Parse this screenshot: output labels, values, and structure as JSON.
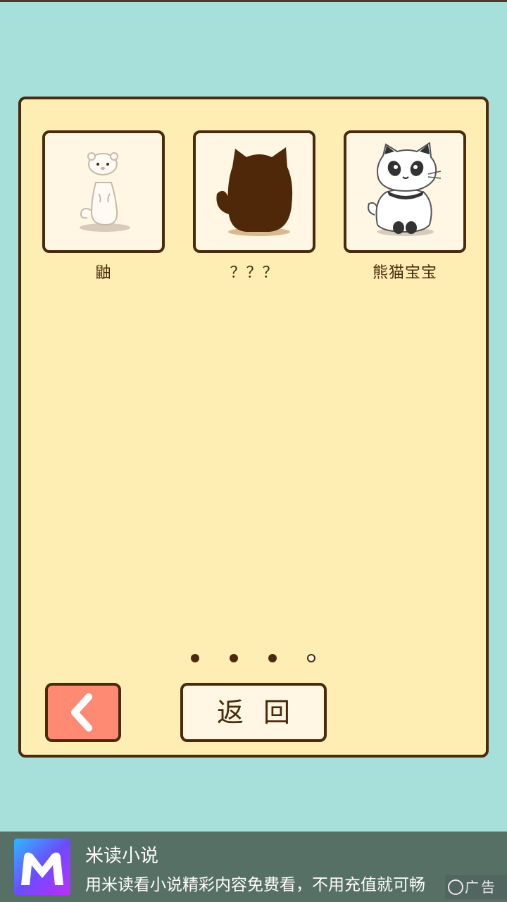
{
  "cards": [
    {
      "label": "鼬",
      "image": "weasel-image"
    },
    {
      "label": "？？？",
      "image": "locked-silhouette-cat"
    },
    {
      "label": "熊猫宝宝",
      "image": "panda-cat-image"
    }
  ],
  "pagination": {
    "total": 4,
    "current": 4
  },
  "buttons": {
    "prev_icon": "chevron-left-icon",
    "back_label": "返回"
  },
  "ad": {
    "app_name": "米读小说",
    "description": "用米读看小说精彩内容免费看，不用充值就可畅",
    "badge": "广告"
  },
  "colors": {
    "background": "#a7e0da",
    "panel": "#ffeeb3",
    "border": "#4a2a0c",
    "prev_button": "#ff8a74",
    "ad_bar": "#577066"
  }
}
